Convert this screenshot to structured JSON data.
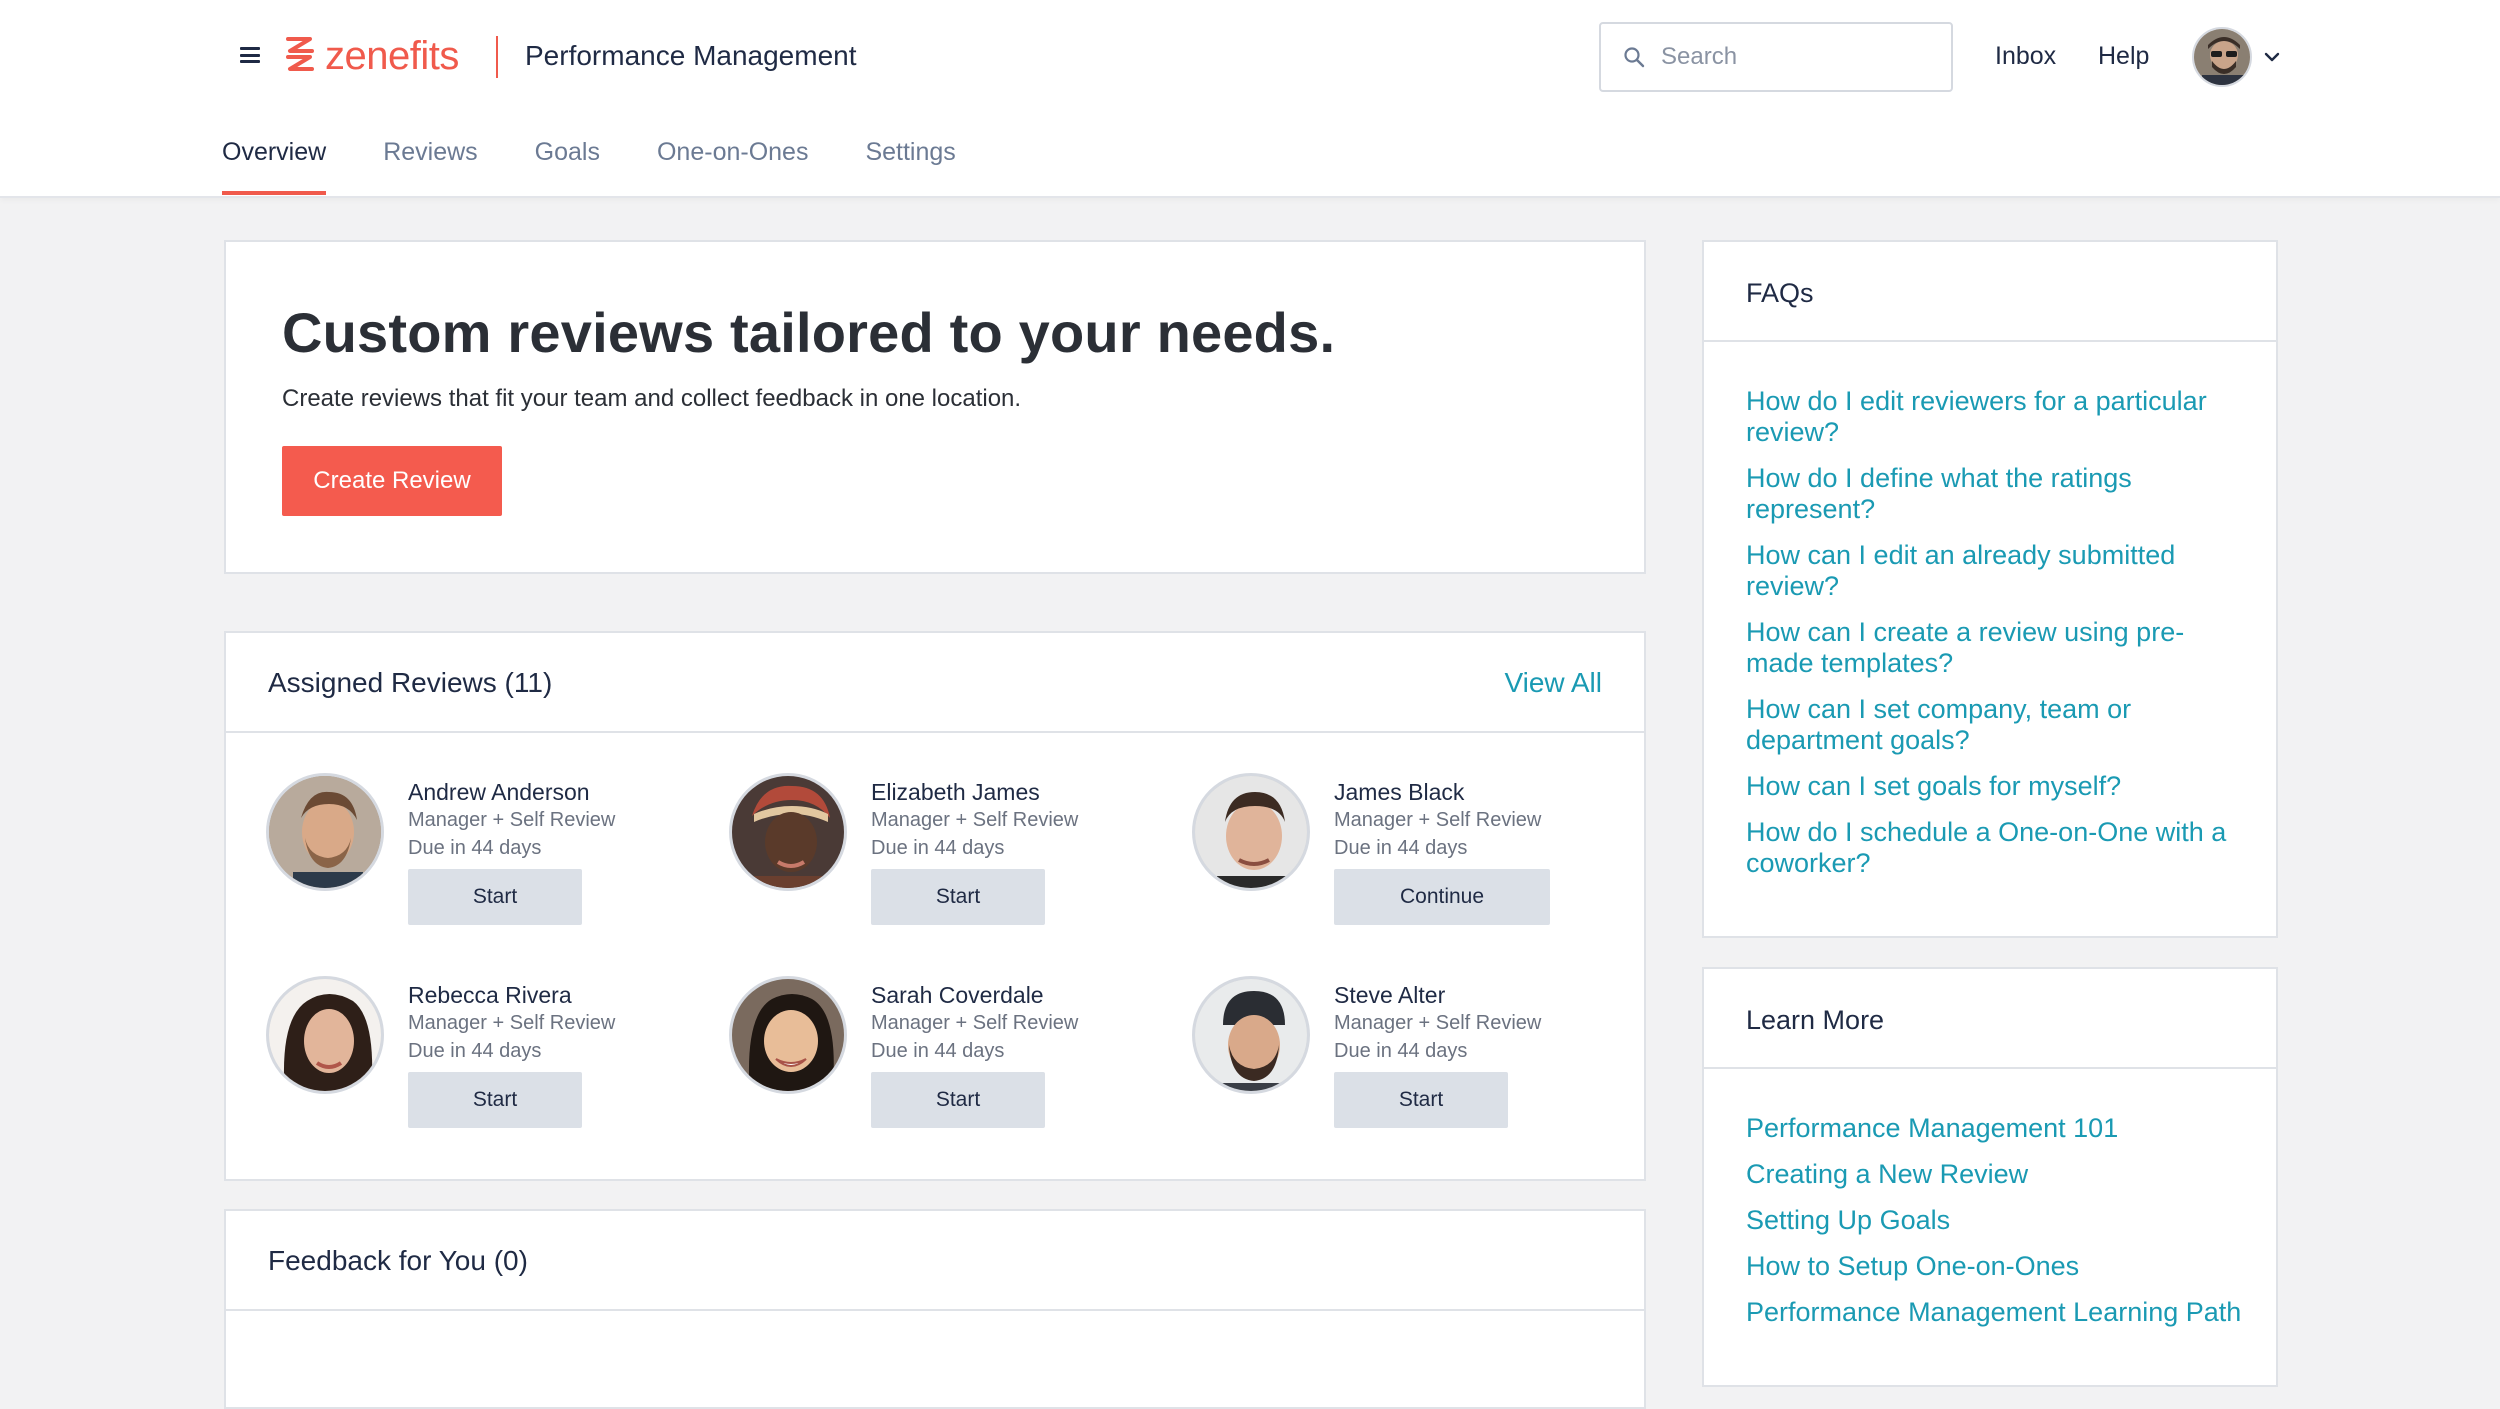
{
  "header": {
    "logo_text": "zenefits",
    "app_title": "Performance Management",
    "search_placeholder": "Search",
    "inbox_label": "Inbox",
    "help_label": "Help"
  },
  "tabs": [
    {
      "label": "Overview",
      "active": true
    },
    {
      "label": "Reviews",
      "active": false
    },
    {
      "label": "Goals",
      "active": false
    },
    {
      "label": "One-on-Ones",
      "active": false
    },
    {
      "label": "Settings",
      "active": false
    }
  ],
  "hero": {
    "title": "Custom reviews tailored to your needs.",
    "subtitle": "Create reviews that fit your team and collect feedback in one location.",
    "button_label": "Create Review"
  },
  "assigned": {
    "title": "Assigned Reviews (11)",
    "view_all_label": "View All",
    "reviewers": [
      {
        "name": "Andrew Anderson",
        "type": "Manager + Self Review",
        "due": "Due in 44 days",
        "action": "Start"
      },
      {
        "name": "Elizabeth James",
        "type": "Manager + Self Review",
        "due": "Due in 44 days",
        "action": "Start"
      },
      {
        "name": "James Black",
        "type": "Manager + Self Review",
        "due": "Due in 44 days",
        "action": "Continue"
      },
      {
        "name": "Rebecca Rivera",
        "type": "Manager + Self Review",
        "due": "Due in 44 days",
        "action": "Start"
      },
      {
        "name": "Sarah Coverdale",
        "type": "Manager + Self Review",
        "due": "Due in 44 days",
        "action": "Start"
      },
      {
        "name": "Steve Alter",
        "type": "Manager + Self Review",
        "due": "Due in 44 days",
        "action": "Start"
      }
    ]
  },
  "feedback": {
    "title": "Feedback for You (0)"
  },
  "faqs": {
    "title": "FAQs",
    "items": [
      "How do I edit reviewers for a particular review?",
      "How do I define what the ratings represent?",
      "How can I edit an already submitted review?",
      "How can I create a review using pre-made templates?",
      "How can I set company, team or department goals?",
      "How can I set goals for myself?",
      "How do I schedule a One-on-One with a coworker?"
    ]
  },
  "learn_more": {
    "title": "Learn More",
    "items": [
      "Performance Management 101",
      "Creating a New Review",
      "Setting Up Goals",
      "How to Setup One-on-Ones",
      "Performance Management Learning Path"
    ]
  },
  "colors": {
    "brand": "#f05a4c",
    "link": "#1a9ab3",
    "text": "#1f2a44"
  }
}
